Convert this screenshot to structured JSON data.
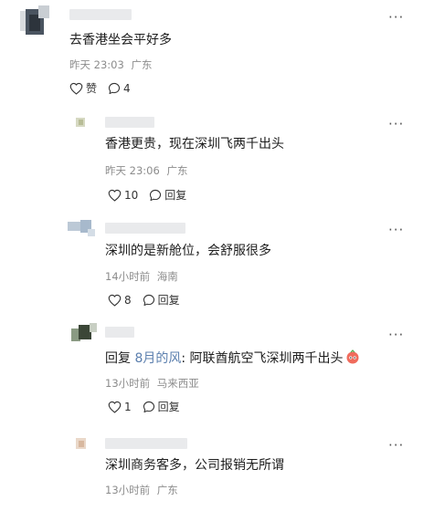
{
  "comments": [
    {
      "text": "去香港坐会平好多",
      "time": "昨天 23:03",
      "location": "广东",
      "like_count": "",
      "like_label": "赞",
      "reply_count": "4",
      "more": "···"
    },
    {
      "text": "香港更贵，现在深圳飞两千出头",
      "time": "昨天 23:06",
      "location": "广东",
      "like_count": "10",
      "reply_label": "回复",
      "more": "···"
    },
    {
      "text": "深圳的是新舱位，会舒服很多",
      "time": "14小时前",
      "location": "海南",
      "like_count": "8",
      "reply_label": "回复",
      "more": "···"
    },
    {
      "reply_prefix": "回复 ",
      "reply_to": "8月的风",
      "text": ": 阿联酋航空飞深圳两千出头",
      "time": "13小时前",
      "location": "马来西亚",
      "like_count": "1",
      "reply_label": "回复",
      "more": "···"
    },
    {
      "text": "深圳商务客多，公司报销无所谓",
      "time": "13小时前",
      "location": "广东",
      "more": "···"
    }
  ],
  "colors": {
    "username_link": "#5b7fae",
    "meta_gray": "#8c8c8c",
    "blur_gray": "#e9eaec"
  },
  "icons": [
    "heart-icon",
    "comment-icon",
    "more-icon",
    "emoji-icon"
  ]
}
